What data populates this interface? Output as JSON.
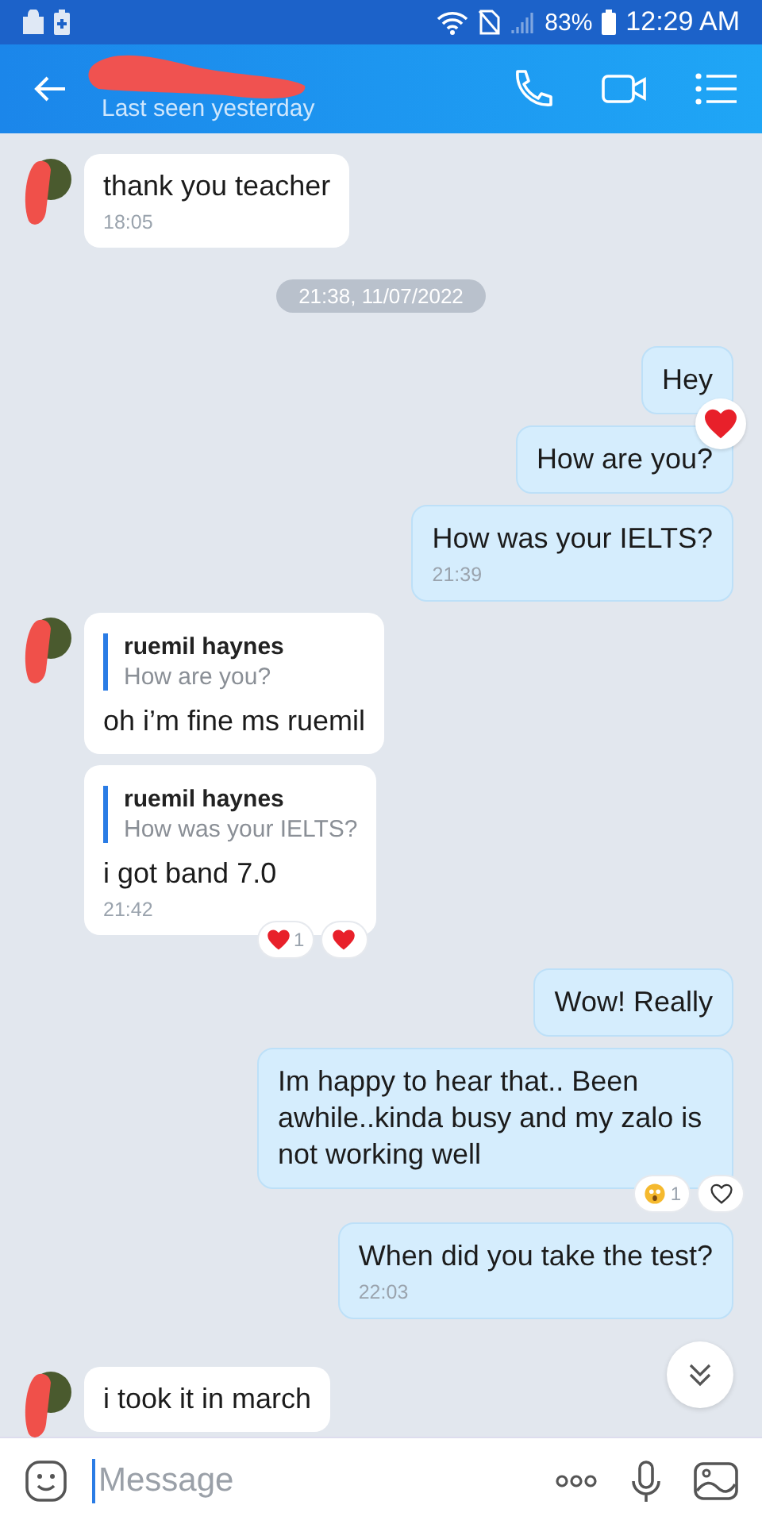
{
  "status_bar": {
    "battery": "83%",
    "time": "12:29 AM"
  },
  "header": {
    "subtitle": "Last seen yesterday"
  },
  "messages": [
    {
      "kind": "incoming",
      "avatar": true,
      "text": "thank you teacher",
      "time": "18:05"
    },
    {
      "kind": "date",
      "text": "21:38, 11/07/2022"
    },
    {
      "kind": "outgoing",
      "text": "Hey",
      "reactions": [
        {
          "kind": "heart-overlay"
        }
      ]
    },
    {
      "kind": "outgoing",
      "text": "How are you?"
    },
    {
      "kind": "outgoing",
      "text": "How was your IELTS?",
      "time": "21:39"
    },
    {
      "kind": "incoming",
      "avatar": true,
      "quote": {
        "author": "ruemil haynes",
        "text": "How are you?"
      },
      "text": "oh i’m fine ms ruemil"
    },
    {
      "kind": "incoming",
      "avatar": false,
      "quote": {
        "author": "ruemil haynes",
        "text": "How was your IELTS?"
      },
      "text": "i got band 7.0",
      "time": "21:42",
      "reactions": [
        {
          "kind": "heart",
          "count": "1"
        },
        {
          "kind": "heart"
        }
      ]
    },
    {
      "kind": "outgoing",
      "text": "Wow! Really"
    },
    {
      "kind": "outgoing",
      "text": "Im happy to hear that.. Been awhile..kinda busy and my zalo is not working well",
      "reactions": [
        {
          "kind": "emoji",
          "count": "1"
        },
        {
          "kind": "outline-heart"
        }
      ]
    },
    {
      "kind": "outgoing",
      "text": "When did you take the test?",
      "time": "22:03"
    },
    {
      "kind": "incoming",
      "avatar": true,
      "text": "i took it in march"
    }
  ],
  "composer": {
    "placeholder": "Message"
  }
}
